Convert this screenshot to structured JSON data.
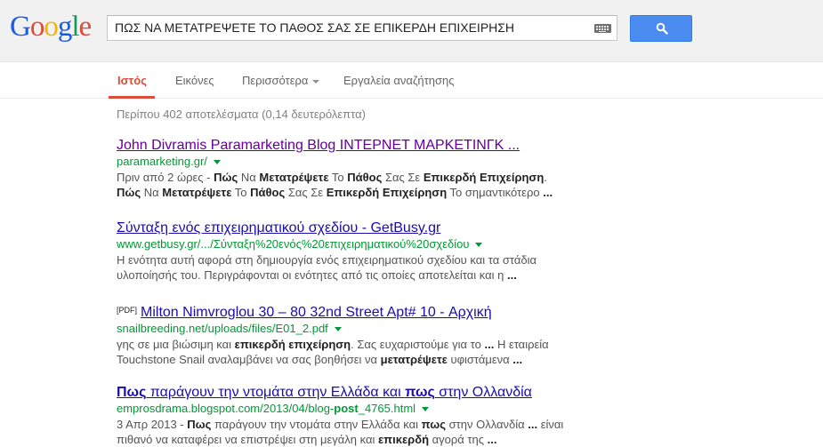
{
  "header": {
    "logo_text": "Google",
    "search_value": "ΠΩΣ ΝΑ ΜΕΤΑΤΡΕΨΕΤΕ ΤΟ ΠΑΘΟΣ ΣΑΣ ΣΕ ΕΠΙΚΕΡΔΗ ΕΠΙΧΕΙΡΗΣΗ",
    "search_icon": "search-icon",
    "keyboard_icon": "keyboard-icon"
  },
  "tabs": {
    "web": "Ιστός",
    "images": "Εικόνες",
    "more": "Περισσότερα",
    "tools": "Εργαλεία αναζήτησης"
  },
  "stats": "Περίπου 402 αποτελέσματα (0,14 δευτερόλεπτα)",
  "results": [
    {
      "title": "John Divramis Paramarketing Blog ΙΝΤΕΡΝΕΤ ΜΑΡΚΕΤΙΝΓΚ ...",
      "url": "paramarketing.gr/",
      "snippet": [
        "Πριν από 2 ώρες - Πώς Να Μετατρέψετε Το Πάθος Σας Σε Επικερδή Επιχείρηση.",
        "Πώς Να Μετατρέψετε Το Πάθος Σας Σε Επικερδή Επιχείρηση Το σημαντικότερο ..."
      ]
    },
    {
      "title": "Σύνταξη ενός επιχειρηματικού σχεδίου - GetBusy.gr",
      "url": "www.getbusy.gr/.../Σύνταξη%20ενός%20επιχειρηματικού%20σχεδίου",
      "snippet": [
        "Η ενότητα αυτή αφορά στη δημιουργία ενός επιχειρηματικού σχεδίου και τα στάδια",
        "υλοποίησής του. Περιγράφονται οι ενότητες από τις οποίες αποτελείται και η ..."
      ]
    },
    {
      "tag": "[PDF]",
      "title": "Milton Nimvroglou 30 – 80 32nd Street Apt# 10 - Αρχική",
      "url": "snailbreeding.net/uploads/files/E01_2.pdf",
      "snippet": [
        "γης σε μια βιώσιμη και επικερδή επιχείρηση. Σας ευχαριστούμε για το ... Η εταιρεία",
        "Touchstone Snail αναλαμβάνει να σας βοηθήσει να μετατρέψετε υφιστάμενα ..."
      ]
    },
    {
      "title": "Πως παράγουν την ντομάτα στην Ελλάδα και πως στην Ολλανδία",
      "url": "emprosdrama.blogspot.com/2013/04/blog-post_4765.html",
      "snippet": [
        "3 Απρ 2013 - Πως παράγουν την ντομάτα στην Ελλάδα και πως στην Ολλανδία ... είναι",
        "πιθανό να καταφέρει να επιστρέψει στη μεγάλη και επικερδή αγορά της ..."
      ]
    }
  ],
  "colors": {
    "accent_red": "#dd4b39",
    "search_blue": "#4b8cf0",
    "url_green": "#009933",
    "visited_purple": "#660099",
    "link_blue": "#1a0dab"
  }
}
